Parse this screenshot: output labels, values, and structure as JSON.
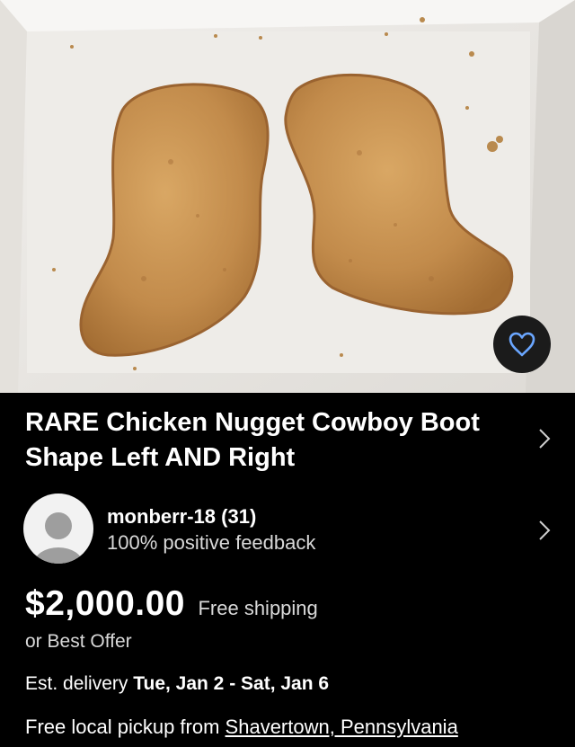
{
  "photo": {
    "subject": "two chicken nuggets shaped like cowboy boots in a paper box",
    "colors": {
      "nugget": "#c08a4a",
      "box": "#e9e7e4",
      "shadow": "#d4d1cc"
    }
  },
  "favorite": {
    "icon": "heart-icon",
    "color": "#6aa6ff"
  },
  "listing": {
    "title": "RARE Chicken Nugget Cowboy Boot Shape Left AND Right",
    "price": "$2,000.00",
    "shipping": "Free shipping",
    "best_offer": "or Best Offer",
    "delivery_label": "Est. delivery",
    "delivery_dates": "Tue, Jan 2 - Sat, Jan 6",
    "pickup_label": "Free local pickup from",
    "pickup_location": "Shavertown, Pennsylvania"
  },
  "seller": {
    "name": "monberr-18 (31)",
    "feedback": "100% positive feedback",
    "avatar_icon": "user-avatar-icon"
  },
  "icons": {
    "chevron": "chevron-right-icon"
  }
}
